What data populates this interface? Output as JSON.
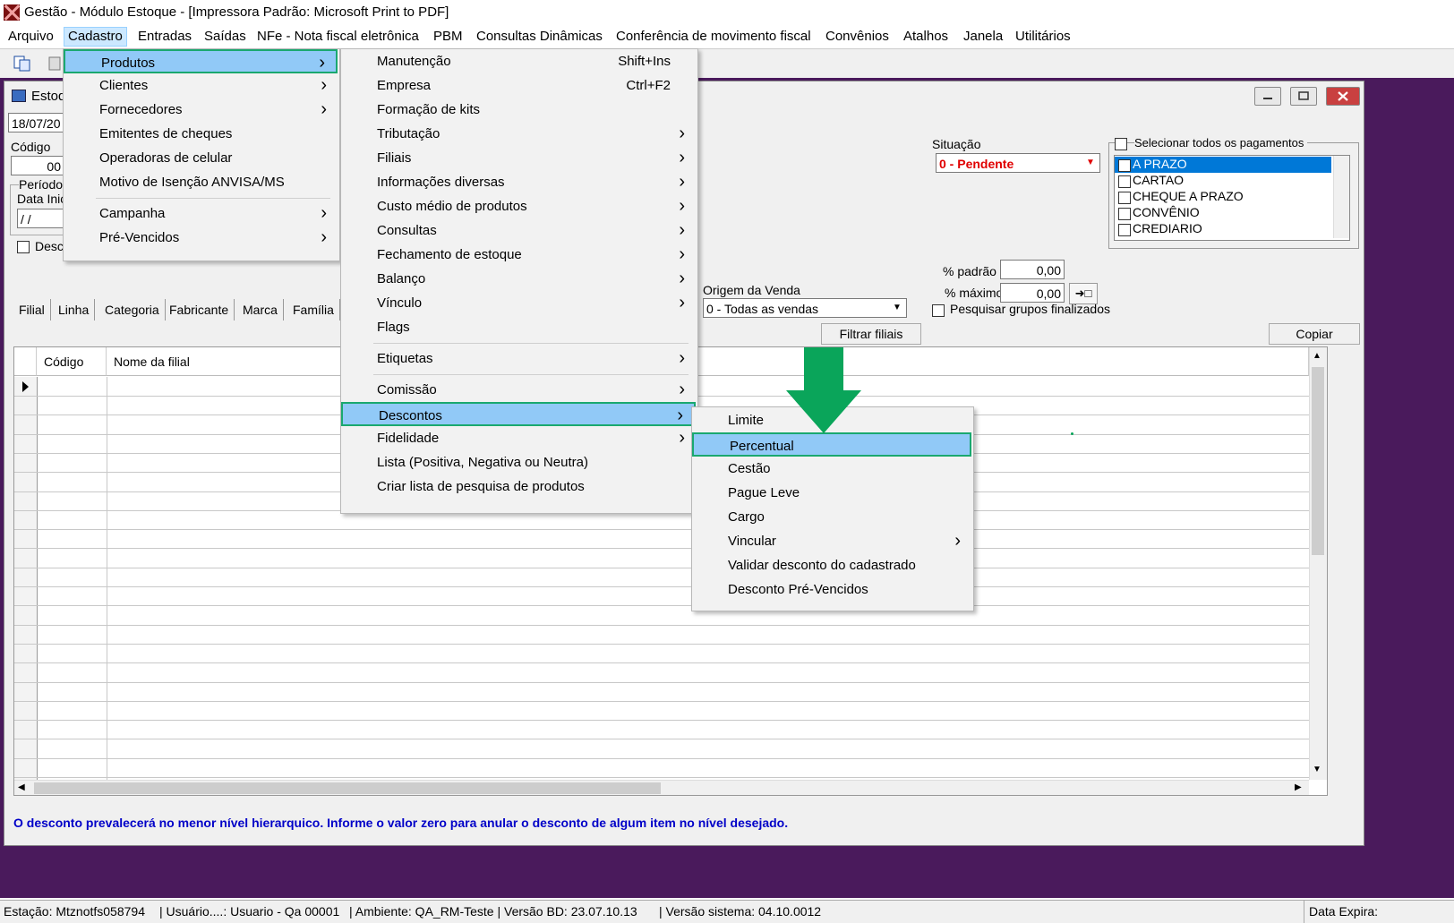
{
  "window": {
    "title": "Gestão  - Módulo Estoque - [Impressora Padrão: Microsoft Print to PDF]"
  },
  "menubar": [
    "Arquivo",
    "Cadastro",
    "Entradas",
    "Saídas",
    "NFe - Nota fiscal eletrônica",
    "PBM",
    "Consultas Dinâmicas",
    "Conferência de movimento fiscal",
    "Convênios",
    "Atalhos",
    "Janela",
    "Utilitários"
  ],
  "child": {
    "title": "Estoq",
    "date": "18/07/20",
    "codigo_label": "Código",
    "codigo_value": "00",
    "periodo_label": "Período",
    "data_inicial_label": "Data Inic",
    "data_inicial_value": "/ /",
    "desc_label": "Desc",
    "situacao_label": "Situação",
    "situacao_value": "0 - Pendente",
    "select_all_label": "Selecionar todos os pagamentos",
    "pagamentos": [
      "A PRAZO",
      "CARTAO",
      "CHEQUE A PRAZO",
      "CONVÊNIO",
      "CREDIARIO"
    ],
    "pct_padrao_label": "% padrão",
    "pct_padrao_value": "0,00",
    "pct_maximo_label": "% máximo",
    "pct_maximo_value": "0,00",
    "origem_label": "Origem da Venda",
    "origem_value": "0 - Todas as vendas",
    "pesquisar_label": "Pesquisar grupos finalizados",
    "tabs": [
      "Filial",
      "Linha",
      "Categoria",
      "Fabricante",
      "Marca",
      "Família"
    ],
    "filtrar_label": "Filtrar filiais",
    "copiar_label": "Copiar",
    "grid_headers": [
      "Código",
      "Nome da filial"
    ],
    "info": "O desconto prevalecerá no menor nível hierarquico. Informe o valor zero para anular o desconto de algum item no nível desejado."
  },
  "menu_cadastro": [
    {
      "label": "Produtos",
      "submenu": true
    },
    {
      "label": "Clientes",
      "submenu": true
    },
    {
      "label": "Fornecedores",
      "submenu": true
    },
    {
      "label": "Emitentes de cheques",
      "submenu": false
    },
    {
      "label": "Operadoras de celular",
      "submenu": false
    },
    {
      "label": "Motivo de Isenção ANVISA/MS",
      "submenu": false
    },
    {
      "label": "Campanha",
      "submenu": true
    },
    {
      "label": "Pré-Vencidos",
      "submenu": true
    }
  ],
  "menu_produtos": [
    {
      "label": "Manutenção",
      "shortcut": "Shift+Ins"
    },
    {
      "label": "Empresa",
      "shortcut": "Ctrl+F2"
    },
    {
      "label": "Formação de kits"
    },
    {
      "label": "Tributação",
      "submenu": true
    },
    {
      "label": "Filiais",
      "submenu": true
    },
    {
      "label": "Informações diversas",
      "submenu": true
    },
    {
      "label": "Custo médio de produtos",
      "submenu": true
    },
    {
      "label": "Consultas",
      "submenu": true
    },
    {
      "label": "Fechamento de estoque",
      "submenu": true
    },
    {
      "label": "Balanço",
      "submenu": true
    },
    {
      "label": "Vínculo",
      "submenu": true
    },
    {
      "label": "Flags"
    },
    {
      "label": "Etiquetas",
      "submenu": true
    },
    {
      "label": "Comissão",
      "submenu": true
    },
    {
      "label": "Descontos",
      "submenu": true
    },
    {
      "label": "Fidelidade",
      "submenu": true
    },
    {
      "label": "Lista (Positiva, Negativa ou Neutra)"
    },
    {
      "label": "Criar lista de pesquisa de produtos"
    }
  ],
  "menu_descontos": [
    {
      "label": "Limite"
    },
    {
      "label": "Percentual"
    },
    {
      "label": "Cestão"
    },
    {
      "label": "Pague Leve"
    },
    {
      "label": "Cargo"
    },
    {
      "label": "Vincular",
      "submenu": true
    },
    {
      "label": "Validar desconto do cadastrado"
    },
    {
      "label": "Desconto Pré-Vencidos"
    }
  ],
  "statusbar": {
    "estacao": "Estação: Mtznotfs058794",
    "usuario": "| Usuário....: Usuario - Qa 00001",
    "ambiente": "| Ambiente: QA_RM-Teste | Versão BD: 23.07.10.13",
    "versao": "| Versão sistema: 04.10.0012",
    "data_expira": "Data Expira:"
  },
  "colors": {
    "highlight": "#91c9f7",
    "outline": "#1aa870",
    "arrow": "#0aa55a",
    "pendente": "#e00000",
    "info": "#0000c8"
  }
}
